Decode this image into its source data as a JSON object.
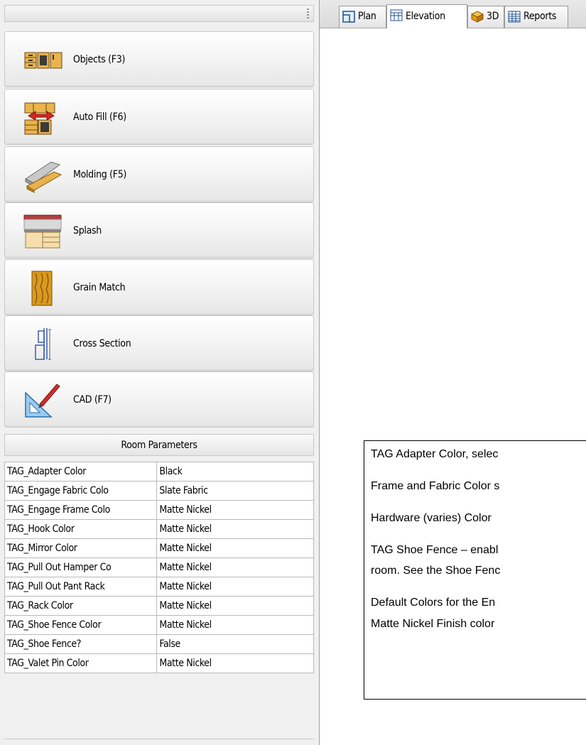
{
  "tool_buttons": [
    {
      "label": "Objects (F3)",
      "icon": "objects-icon"
    },
    {
      "label": "Auto Fill (F6)",
      "icon": "auto-fill-icon"
    },
    {
      "label": "Molding (F5)",
      "icon": "molding-icon"
    },
    {
      "label": "Splash",
      "icon": "splash-icon"
    },
    {
      "label": "Grain Match",
      "icon": "grain-match-icon"
    },
    {
      "label": "Cross Section",
      "icon": "cross-section-icon"
    },
    {
      "label": "CAD (F7)",
      "icon": "cad-icon"
    }
  ],
  "room_parameters": {
    "header": "Room Parameters",
    "rows": [
      {
        "name": "TAG_Adapter Color",
        "value": "Black"
      },
      {
        "name": "TAG_Engage Fabric Colo",
        "value": "Slate Fabric"
      },
      {
        "name": "TAG_Engage Frame Colo",
        "value": "Matte Nickel"
      },
      {
        "name": "TAG_Hook Color",
        "value": "Matte Nickel"
      },
      {
        "name": "TAG_Mirror Color",
        "value": "Matte Nickel"
      },
      {
        "name": "TAG_Pull Out Hamper Co",
        "value": "Matte Nickel"
      },
      {
        "name": "TAG_Pull Out Pant Rack",
        "value": "Matte Nickel"
      },
      {
        "name": "TAG_Rack Color",
        "value": "Matte Nickel"
      },
      {
        "name": "TAG_Shoe Fence Color",
        "value": "Matte Nickel"
      },
      {
        "name": "TAG_Shoe Fence?",
        "value": "False"
      },
      {
        "name": "TAG_Valet Pin Color",
        "value": "Matte Nickel"
      }
    ]
  },
  "tabs": [
    {
      "label": "Plan",
      "icon": "plan-icon",
      "active": false
    },
    {
      "label": "Elevation",
      "icon": "elevation-icon",
      "active": true
    },
    {
      "label": "3D",
      "icon": "3d-cube-icon",
      "active": false
    },
    {
      "label": "Reports",
      "icon": "reports-icon",
      "active": false
    }
  ],
  "annotation": {
    "lines": [
      "TAG Adapter Color, selec",
      "Frame and Fabric Color s",
      "Hardware (varies) Color",
      "TAG Shoe Fence – enabl",
      "room. See the Shoe Fenc",
      "Default Colors for the En",
      "Matte Nickel Finish color"
    ]
  }
}
